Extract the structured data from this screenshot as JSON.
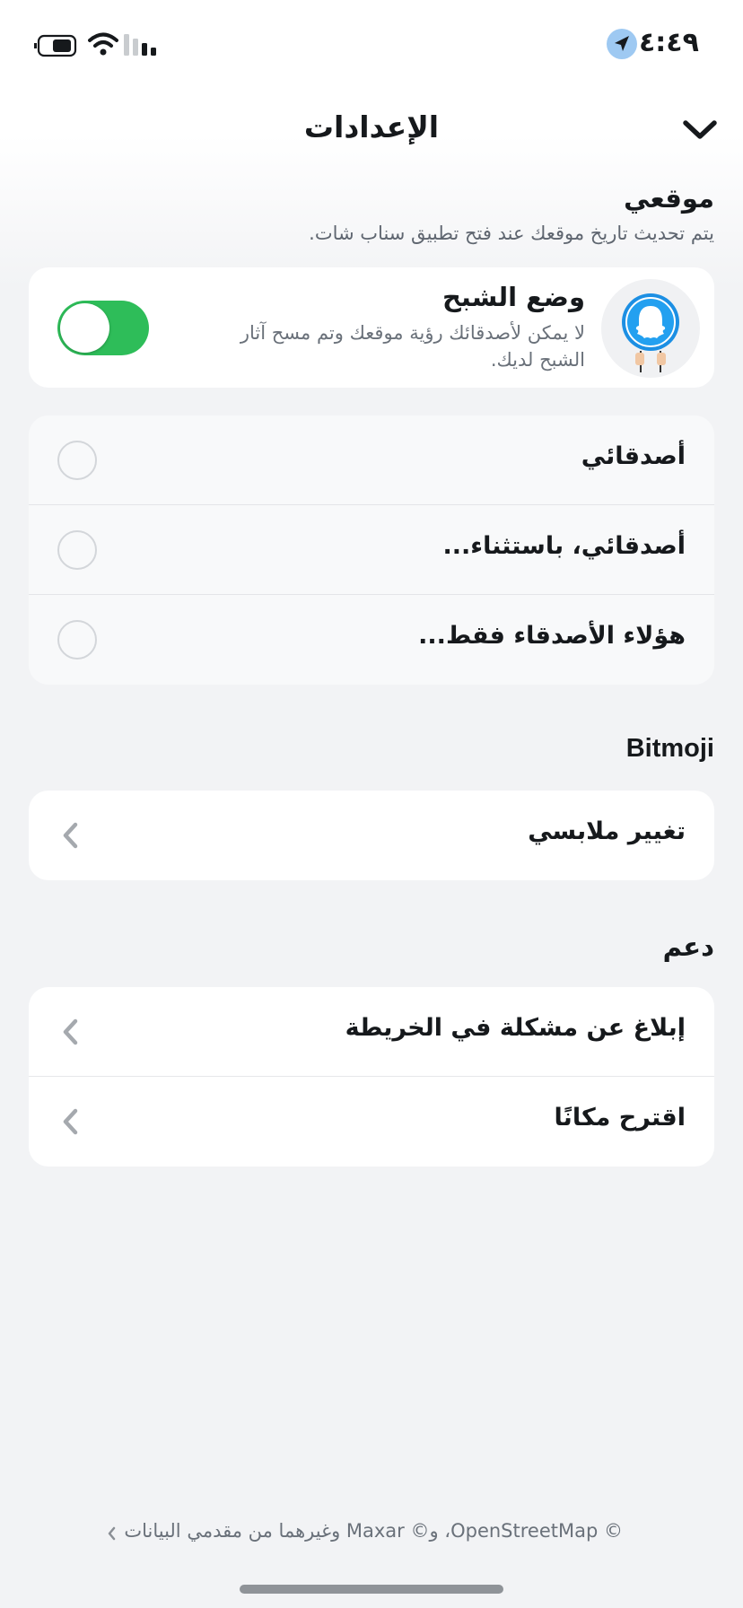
{
  "status_bar": {
    "time": "٤:٤٩"
  },
  "header": {
    "title": "الإعدادات"
  },
  "my_location": {
    "title": "موقعي",
    "subtitle": "يتم تحديث تاريخ موقعك عند فتح تطبيق سناب شات.",
    "ghost_mode": {
      "title": "وضع الشبح",
      "description": "لا يمكن لأصدقائك رؤية موقعك وتم مسح آثار الشبح لديك.",
      "enabled": true
    },
    "options": [
      {
        "label": "أصدقائي",
        "selected": false
      },
      {
        "label": "أصدقائي، باستثناء...",
        "selected": false
      },
      {
        "label": "هؤلاء الأصدقاء فقط...",
        "selected": false
      }
    ]
  },
  "bitmoji": {
    "title": "Bitmoji",
    "items": [
      {
        "label": "تغيير ملابسي"
      }
    ]
  },
  "support": {
    "title": "دعم",
    "items": [
      {
        "label": "إبلاغ عن مشكلة في الخريطة"
      },
      {
        "label": "اقترح مكانًا"
      }
    ]
  },
  "footer": {
    "attribution": "© OpenStreetMap، و© Maxar وغيرهما من مقدمي البيانات"
  },
  "colors": {
    "toggle_on": "#2ebd59",
    "snap_blue": "#1c8fe3",
    "location_badge": "#9ec9f2"
  }
}
